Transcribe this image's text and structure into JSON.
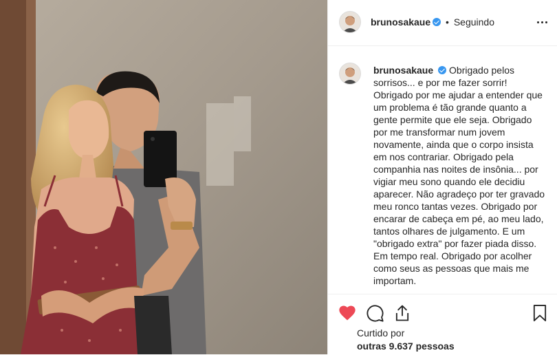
{
  "post": {
    "username": "brunosakaue",
    "follow_status": "Seguindo",
    "separator": "•",
    "caption": "Obrigado pelos sorrisos... e por me fazer sorrir! Obrigado por me ajudar a entender que um problema é tão grande quanto a gente permite que ele seja. Obrigado por me transformar num jovem novamente, ainda que o corpo insista em nos contrariar. Obrigado pela companhia nas noites de insônia... por vigiar meu sono quando ele decidiu aparecer. Não agradeço por ter gravado meu ronco tantas vezes. Obrigado por encarar de cabeça em pé, ao meu lado, tantos olhares de julgamento. E um \"obrigado extra\" por fazer piada disso. Em tempo real. Obrigado por acolher como seus as pessoas que mais me importam.",
    "liked_label": "Curtido por",
    "likes_count": "outras 9.637 pessoas"
  },
  "icons": {
    "like": "heart-icon",
    "comment": "comment-icon",
    "share": "share-icon",
    "save": "bookmark-icon",
    "options": "more-options-icon",
    "verified": "verified-badge-icon"
  },
  "colors": {
    "like": "#ed4956",
    "verified": "#3897f0",
    "text": "#262626",
    "border": "#efefef"
  }
}
